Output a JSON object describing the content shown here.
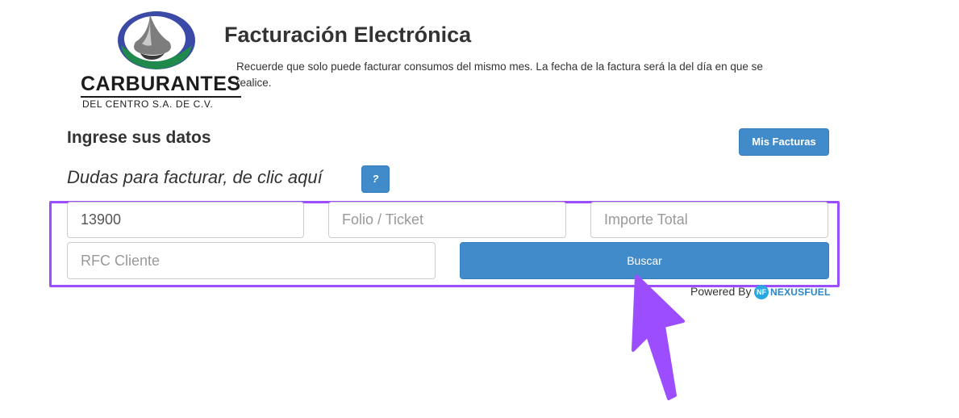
{
  "logo": {
    "name": "CARBURANTES",
    "subtitle": "DEL CENTRO S.A. DE C.V."
  },
  "header": {
    "title": "Facturación Electrónica",
    "notice": "Recuerde que solo puede facturar consumos del mismo mes. La fecha de la factura será la del día en que se realice."
  },
  "section": {
    "title": "Ingrese sus datos",
    "help_text": "Dudas para facturar, de clic aquí",
    "help_button": "?",
    "my_invoices_button": "Mis Facturas"
  },
  "form": {
    "station_value": "13900",
    "folio_placeholder": "Folio / Ticket",
    "importe_placeholder": "Importe Total",
    "rfc_placeholder": "RFC Cliente",
    "search_button": "Buscar"
  },
  "footer": {
    "powered_by": "Powered By",
    "brand_mark": "NF",
    "brand_name": "NEXUSFUEL"
  },
  "colors": {
    "primary": "#428bca",
    "highlight": "#9b4dff",
    "logo_blue": "#3a4aa6",
    "logo_green": "#1f8a4c",
    "nexus": "#2a86c8"
  }
}
